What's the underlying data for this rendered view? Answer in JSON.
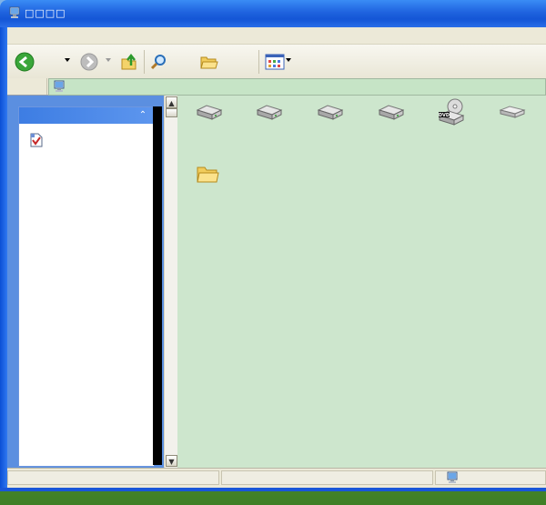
{
  "window": {
    "title": "□□□□"
  },
  "menubar": {
    "items": []
  },
  "toolbar": {
    "back": "back-icon",
    "forward": "forward-icon",
    "up": "folder-up-icon",
    "search": "search-icon",
    "folders": "folders-icon",
    "views": "views-icon"
  },
  "address": {
    "value": "",
    "icon": "computer-icon"
  },
  "left_pane": {
    "panel_title": "",
    "items": [
      {
        "label": "",
        "icon": "document-icon"
      }
    ]
  },
  "content": {
    "items": [
      {
        "label": "",
        "icon": "hard-drive-icon"
      },
      {
        "label": "",
        "icon": "hard-drive-icon"
      },
      {
        "label": "",
        "icon": "hard-drive-icon"
      },
      {
        "label": "",
        "icon": "hard-drive-icon"
      },
      {
        "label": "",
        "icon": "dvd-drive-icon"
      },
      {
        "label": "",
        "icon": "removable-drive-icon"
      },
      {
        "label": "",
        "icon": "folder-icon"
      }
    ]
  },
  "statusbar": {
    "left": "",
    "middle": "",
    "right": "",
    "icon": "computer-icon"
  },
  "colors": {
    "titlebar": "#1f63df",
    "content_bg": "#cde6cd",
    "address_bg": "#c6e4c6",
    "pane_bg": "#5b8fe0"
  }
}
